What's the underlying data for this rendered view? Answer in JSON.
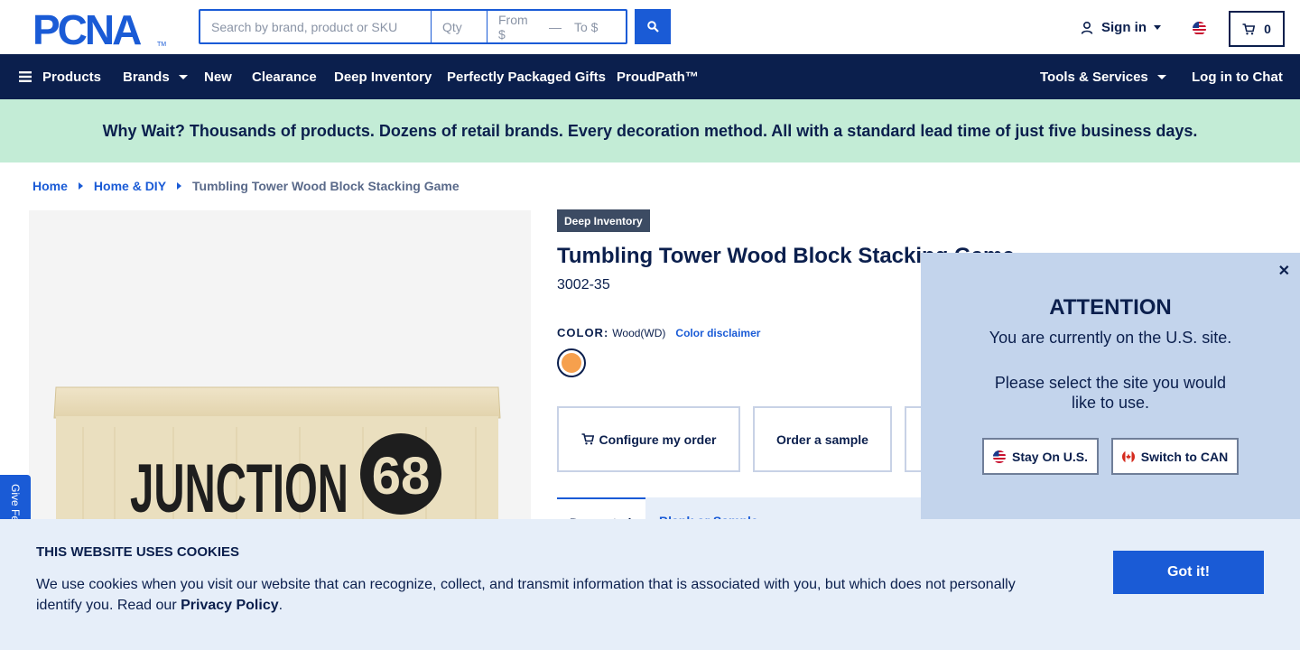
{
  "header": {
    "logo_text": "PCNA",
    "search": {
      "placeholder": "Search by brand, product or SKU",
      "qty_placeholder": "Qty",
      "from_placeholder": "From $",
      "to_placeholder": "To $",
      "icon": "search-icon"
    },
    "signin_label": "Sign in",
    "cart_count": "0"
  },
  "nav": {
    "products": "Products",
    "brands": "Brands",
    "new": "New",
    "clearance": "Clearance",
    "deep_inventory": "Deep Inventory",
    "gifts": "Perfectly Packaged Gifts",
    "proudpath": "ProudPath™",
    "tools": "Tools & Services",
    "chat": "Log in to Chat"
  },
  "promo": {
    "text": "Why Wait? Thousands of products. Dozens of retail brands. Every decoration method. All with a standard lead time of just five business days."
  },
  "breadcrumb": {
    "home": "Home",
    "category": "Home & DIY",
    "current": "Tumbling Tower Wood Block Stacking Game"
  },
  "product": {
    "badge": "Deep Inventory",
    "title": "Tumbling Tower Wood Block Stacking Game",
    "sku": "3002-35",
    "color_label": "COLOR:",
    "color_value": "Wood(WD)",
    "color_disclaimer": "Color disclaimer",
    "swatch_color": "#f6a04d",
    "image_text": "JUNCTION",
    "image_badge": "68",
    "actions": {
      "configure": "Configure my order",
      "sample": "Order a sample"
    },
    "tabs": {
      "first": "Decorated",
      "second": "Blank or Sample"
    }
  },
  "attention": {
    "title": "ATTENTION",
    "line1": "You are currently on the U.S. site.",
    "line2": "Please select the site you would like to use.",
    "stay": "Stay On U.S.",
    "switch": "Switch to CAN"
  },
  "feedback": {
    "label": "Give Feedback"
  },
  "cookie": {
    "title": "THIS WEBSITE USES COOKIES",
    "text": "We use cookies when you visit our website that can recognize, collect, and transmit information that is associated with you, but which does not personally identify you. Read our ",
    "link": "Privacy Policy",
    "end": ".",
    "button": "Got it!"
  },
  "colors": {
    "navy": "#0b1f4d",
    "accent": "#1a5bd6",
    "promo_bg": "#c3ecd6",
    "popup_bg": "#c3d4ec",
    "cookie_bg": "#e6eef9"
  }
}
